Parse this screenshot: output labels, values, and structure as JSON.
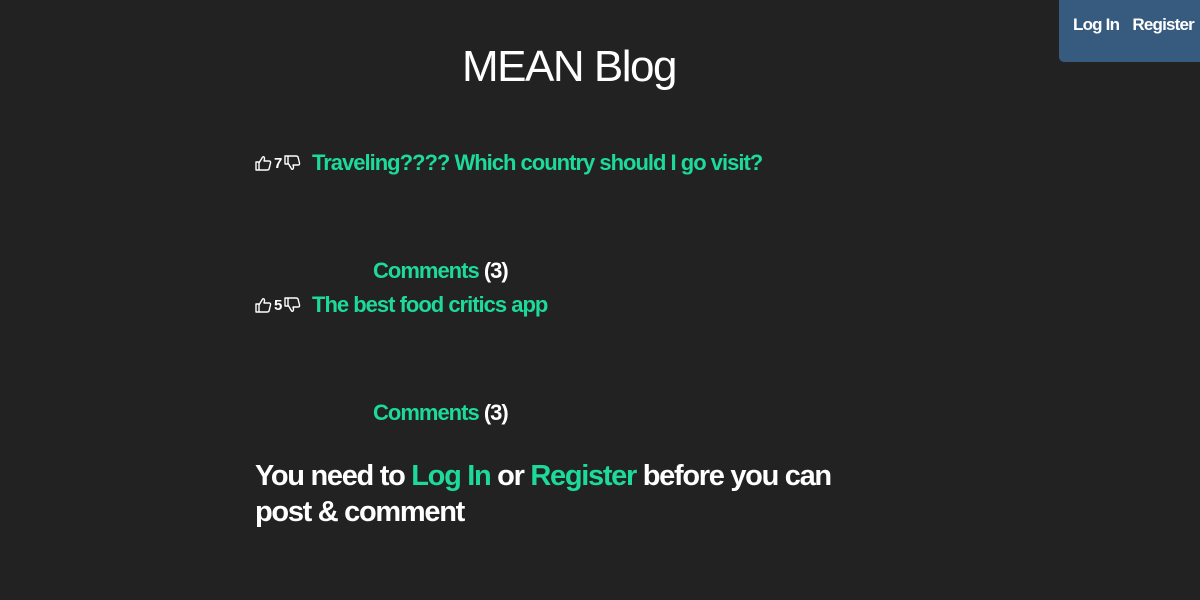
{
  "nav": {
    "login_label": "Log In",
    "register_label": "Register"
  },
  "page_title": "MEAN Blog",
  "posts": [
    {
      "votes": "7",
      "title": "Traveling???? Which country should I go visit?",
      "comments_label": "Comments",
      "comments_count": "(3)"
    },
    {
      "votes": "5",
      "title": "The best food critics app",
      "comments_label": "Comments",
      "comments_count": "(3)"
    }
  ],
  "notice": {
    "prefix": "You need to ",
    "login_link": "Log In",
    "middle": " or ",
    "register_link": "Register",
    "suffix": " before you can post & comment"
  },
  "icons": {
    "upvote": "thumbs-up-icon",
    "downvote": "thumbs-down-icon"
  },
  "colors": {
    "background": "#222222",
    "navbar": "#375a7f",
    "link": "#1dd99a",
    "text": "#ffffff"
  }
}
